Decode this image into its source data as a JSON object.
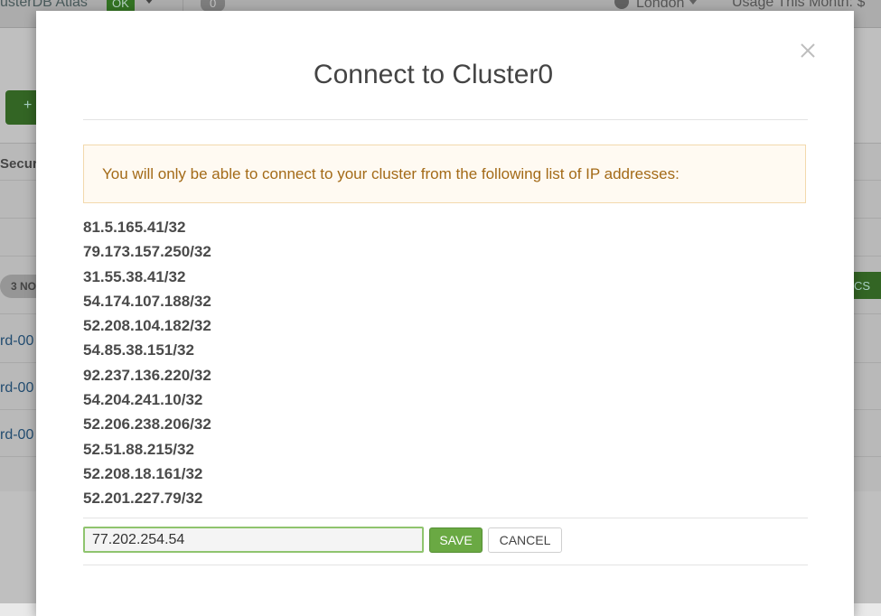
{
  "background": {
    "brand": "usterDB Atlas",
    "status_badge": "OK",
    "count": "0",
    "region": "London",
    "usage": "Usage This Month: $",
    "add_button": "+",
    "column_head": "Secur",
    "nodes_pill": "3 NO",
    "metrics_button": "RICS",
    "shard_links": [
      "rd-00",
      "rd-00",
      "rd-00"
    ]
  },
  "modal": {
    "title": "Connect to Cluster0",
    "warning": "You will only be able to connect to your cluster from the following list of IP addresses:",
    "ip_addresses": [
      "81.5.165.41/32",
      "79.173.157.250/32",
      "31.55.38.41/32",
      "54.174.107.188/32",
      "52.208.104.182/32",
      "54.85.38.151/32",
      "92.237.136.220/32",
      "54.204.241.10/32",
      "52.206.238.206/32",
      "52.51.88.215/32",
      "52.208.18.161/32",
      "52.201.227.79/32"
    ],
    "ip_input_value": "77.202.254.54",
    "save_label": "SAVE",
    "cancel_label": "CANCEL"
  },
  "colors": {
    "accent_green": "#6aa943",
    "warning_text": "#a36a17",
    "warning_bg": "#fffaf2"
  }
}
